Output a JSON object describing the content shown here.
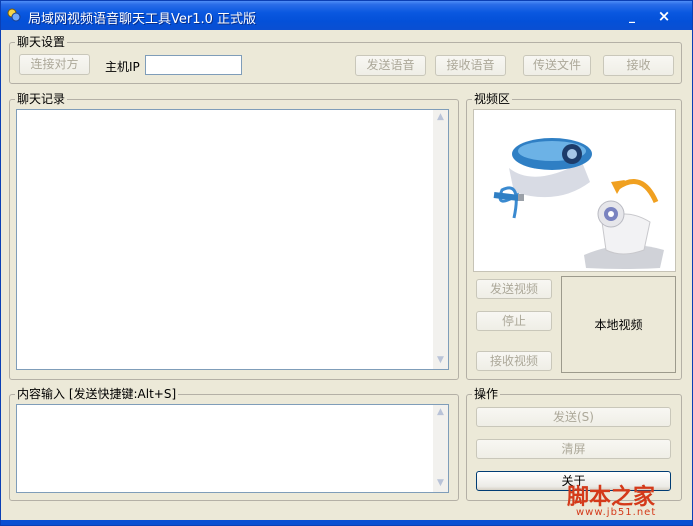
{
  "window": {
    "title": "局域网视频语音聊天工具Ver1.0 正式版"
  },
  "settings": {
    "group_title": "聊天设置",
    "connect_label": "连接对方",
    "host_ip_label": "主机IP",
    "host_ip_value": "",
    "send_voice_label": "发送语音",
    "receive_voice_label": "接收语音",
    "send_file_label": "传送文件",
    "receive_label": "接收"
  },
  "chat_log": {
    "group_title": "聊天记录",
    "content": ""
  },
  "video": {
    "group_title": "视频区",
    "send_video_label": "发送视频",
    "stop_label": "停止",
    "receive_video_label": "接收视频",
    "local_video_label": "本地视频"
  },
  "input": {
    "group_title": "内容输入 [发送快捷键:Alt+S]",
    "content": ""
  },
  "actions": {
    "group_title": "操作",
    "send_label": "发送(S)",
    "clear_label": "清屏",
    "close_label": "关于"
  },
  "watermark": {
    "text": "脚本之家",
    "url": "www.jb51.net"
  }
}
